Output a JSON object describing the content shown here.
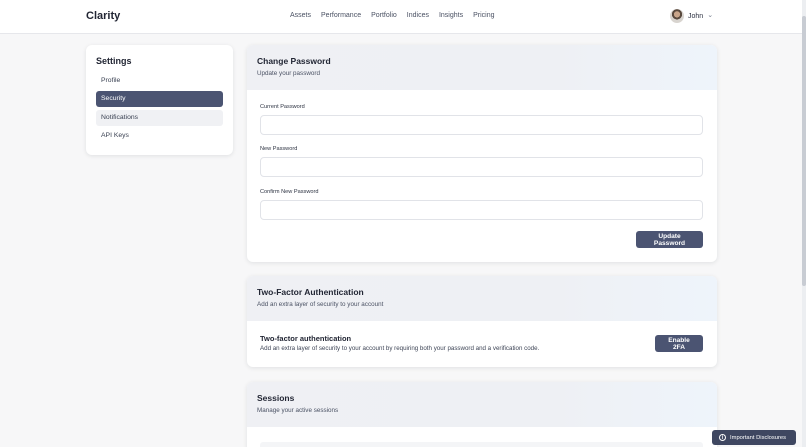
{
  "app": {
    "brand": "Clarity"
  },
  "nav": {
    "items": [
      {
        "label": "Assets"
      },
      {
        "label": "Performance"
      },
      {
        "label": "Portfolio"
      },
      {
        "label": "Indices"
      },
      {
        "label": "Insights"
      },
      {
        "label": "Pricing"
      }
    ]
  },
  "user": {
    "name": "John",
    "menu_icon": "chevron-down-icon"
  },
  "sidebar": {
    "title": "Settings",
    "items": [
      {
        "label": "Profile"
      },
      {
        "label": "Security",
        "active": true
      },
      {
        "label": "Notifications"
      },
      {
        "label": "API Keys"
      }
    ]
  },
  "password": {
    "title": "Change Password",
    "subtitle": "Update your password",
    "fields": [
      {
        "label": "Current Password",
        "value": ""
      },
      {
        "label": "New Password",
        "value": ""
      },
      {
        "label": "Confirm New Password",
        "value": ""
      }
    ],
    "submit_label": "Update Password"
  },
  "two_factor": {
    "title": "Two-Factor Authentication",
    "subtitle": "Add an extra layer of security to your account",
    "row_title": "Two-factor authentication",
    "row_desc": "Add an extra layer of security to your account by requiring both your password and a verification code.",
    "enable_label": "Enable 2FA"
  },
  "sessions": {
    "title": "Sessions",
    "subtitle": "Manage your active sessions"
  },
  "disclosure": {
    "label": "Important Disclosures",
    "icon": "info-icon"
  },
  "colors": {
    "accent": "#4b5472",
    "page_bg": "#f7f7f8"
  }
}
